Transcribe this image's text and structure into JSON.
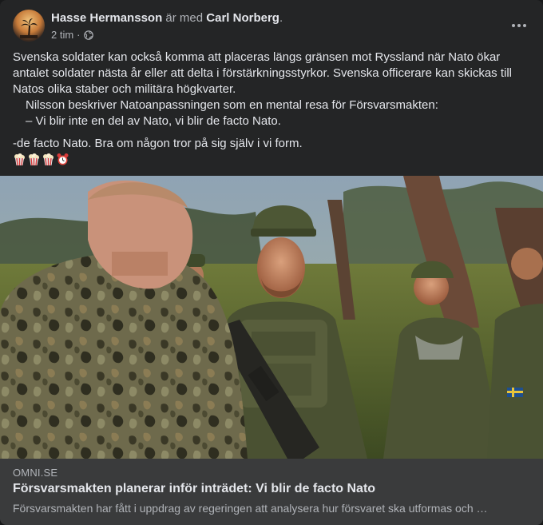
{
  "post": {
    "author": "Hasse Hermansson",
    "with_text": "är med",
    "tagged": "Carl Norberg",
    "period": ".",
    "time": "2 tim",
    "separator": "·",
    "audience_icon": "globe-icon",
    "more_icon": "more-options-icon",
    "body": {
      "p1": "Svenska soldater kan också komma att placeras längs gränsen mot Ryssland när Nato ökar antalet soldater nästa år eller att delta i förstärkningsstyrkor. Svenska officerare kan skickas till Natos olika staber och militära högkvarter.",
      "p2": "Nilsson beskriver Natoanpassningen som en mental resa för Försvarsmakten:",
      "p3": "– Vi blir inte en del av Nato, vi blir de facto Nato.",
      "p4": "-de facto Nato. Bra om någon tror på sig själv i vi form.",
      "emojis": [
        "popcorn",
        "popcorn",
        "popcorn",
        "alarm-clock"
      ]
    }
  },
  "link_preview": {
    "domain": "OMNI.SE",
    "title": "Försvarsmakten planerar inför inträdet: Vi blir de facto Nato",
    "description": "Försvarsmakten har fått i uppdrag av regeringen att analysera hur försvaret ska utformas och …"
  },
  "colors": {
    "card_bg": "#242526",
    "link_bg": "#3a3b3c",
    "text_primary": "#e4e6eb",
    "text_secondary": "#b0b3b8"
  }
}
